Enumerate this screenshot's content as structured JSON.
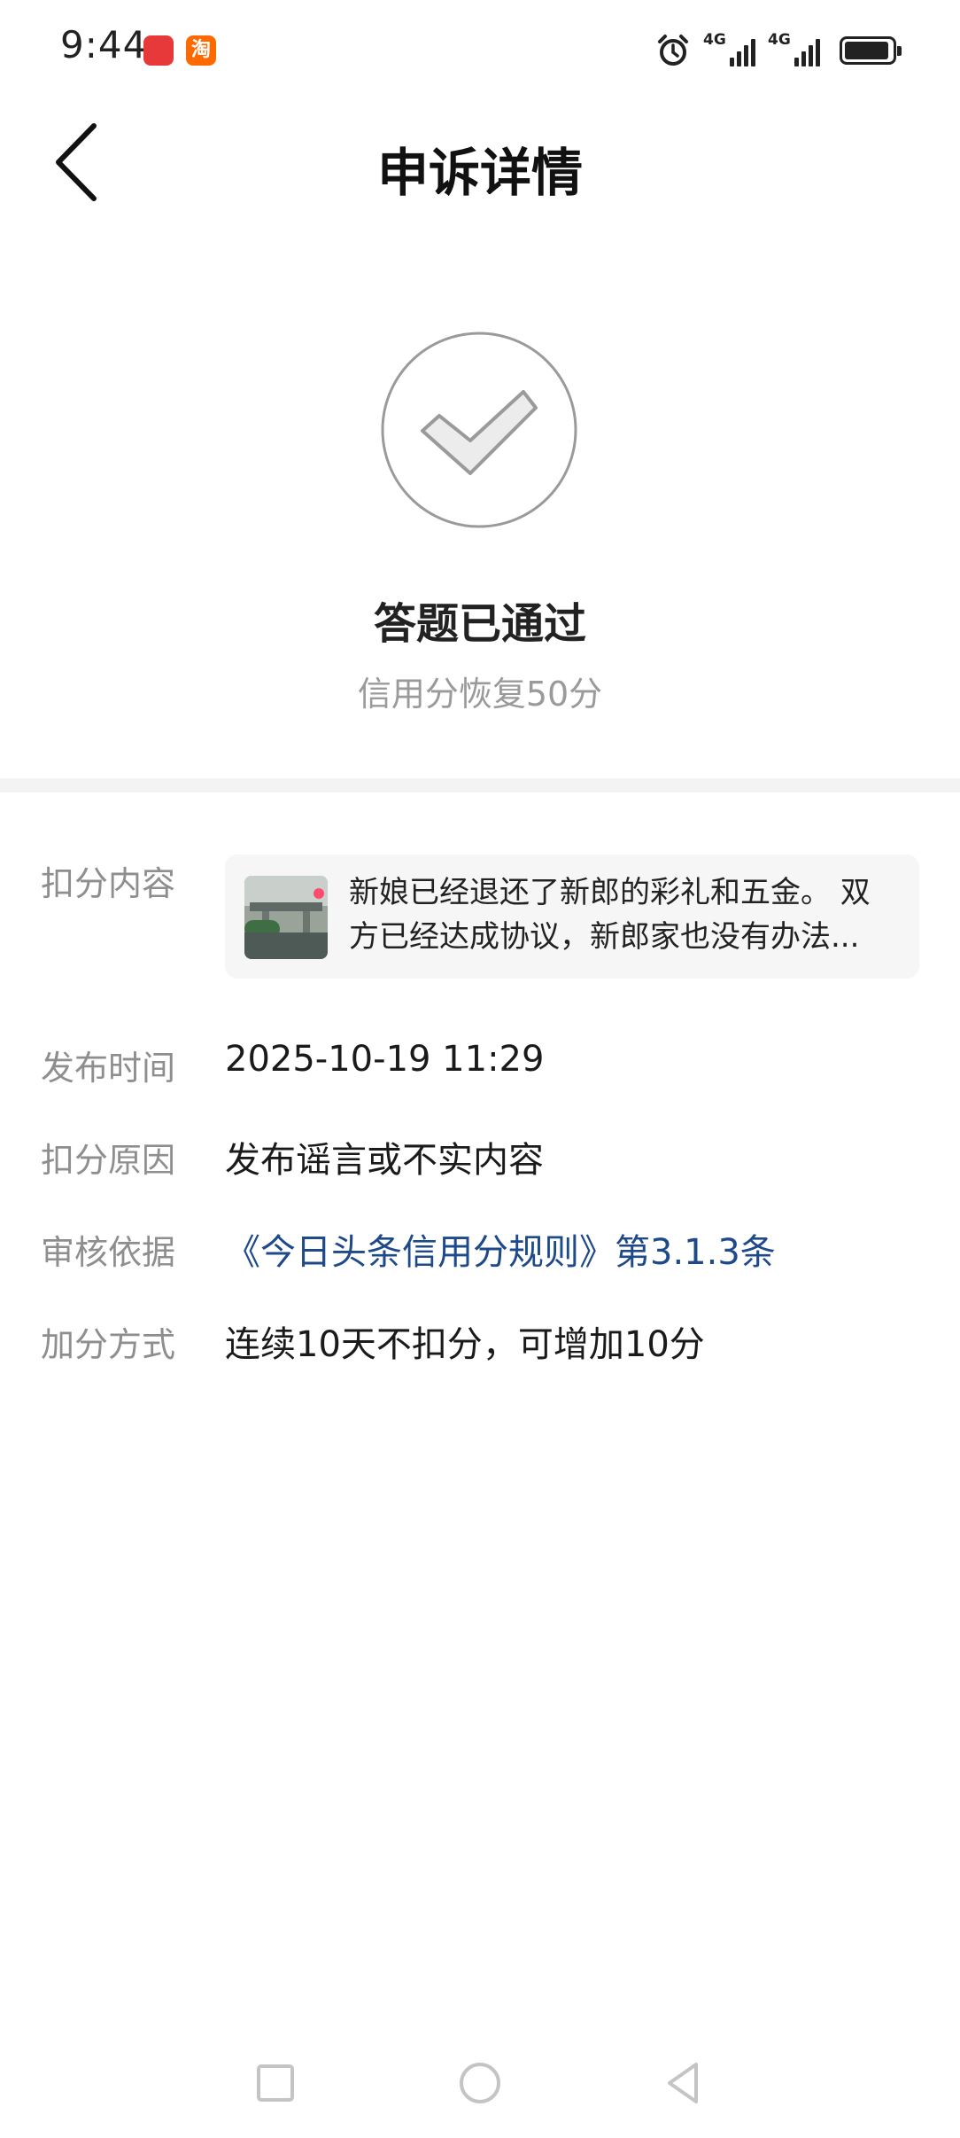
{
  "status_bar": {
    "time": "9:44",
    "taobao_badge": "淘",
    "signal_1_label": "4G",
    "signal_2_label": "4G",
    "battery_level": 0.95
  },
  "header": {
    "title": "申诉详情"
  },
  "result": {
    "title": "答题已通过",
    "subtitle": "信用分恢复50分"
  },
  "details": {
    "content_label": "扣分内容",
    "content_text": "新娘已经退还了新郎的彩礼和五金。 双方已经达成协议，新郎家也没有办法...",
    "publish_time_label": "发布时间",
    "publish_time_value": "2025-10-19 11:29",
    "reason_label": "扣分原因",
    "reason_value": "发布谣言或不实内容",
    "basis_label": "审核依据",
    "basis_value": "《今日头条信用分规则》第3.1.3条",
    "bonus_label": "加分方式",
    "bonus_value": "连续10天不扣分，可增加10分"
  },
  "colors": {
    "link": "#1e4a8a",
    "label_gray": "#8e8e8e",
    "divider": "#f3f3f3"
  }
}
